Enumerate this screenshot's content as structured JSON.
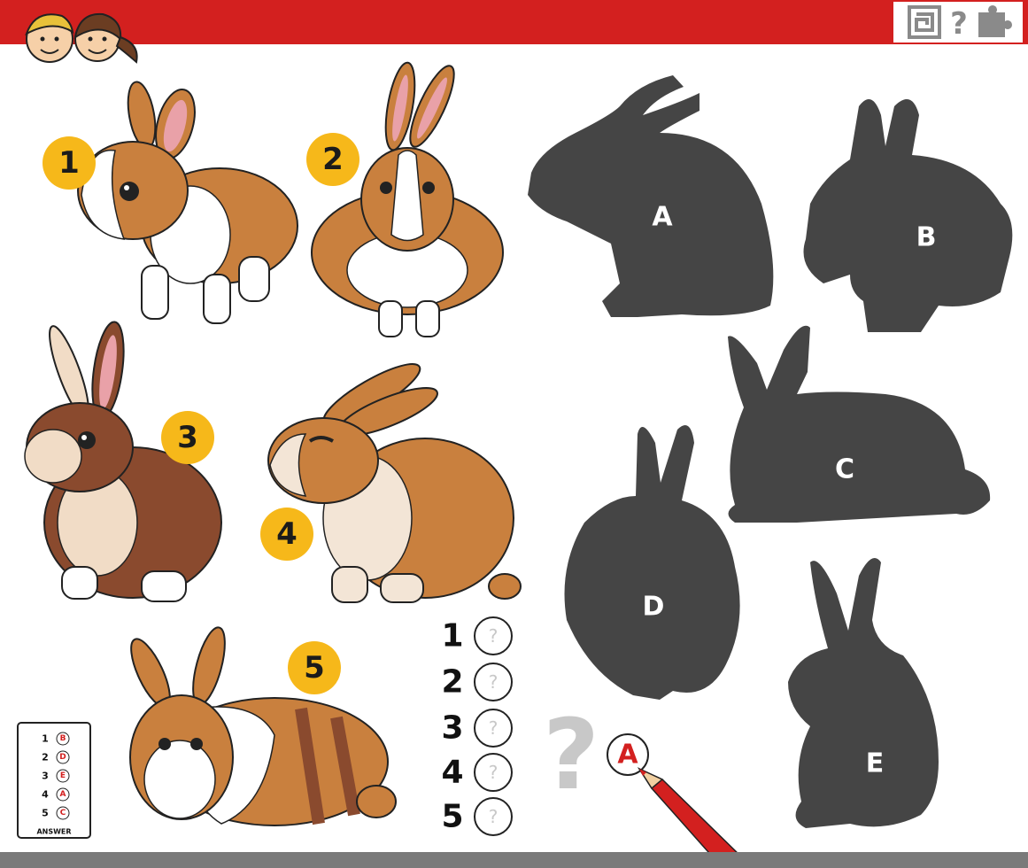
{
  "header": {
    "bar_color": "#d3201f",
    "icons": [
      "maze-icon",
      "question-icon",
      "puzzle-icon"
    ]
  },
  "rabbits": [
    {
      "number": "1"
    },
    {
      "number": "2"
    },
    {
      "number": "3"
    },
    {
      "number": "4"
    },
    {
      "number": "5"
    }
  ],
  "shadows": [
    {
      "letter": "A"
    },
    {
      "letter": "B"
    },
    {
      "letter": "C"
    },
    {
      "letter": "D"
    },
    {
      "letter": "E"
    }
  ],
  "answer_rows": [
    {
      "number": "1",
      "placeholder": "?"
    },
    {
      "number": "2",
      "placeholder": "?"
    },
    {
      "number": "3",
      "placeholder": "?"
    },
    {
      "number": "4",
      "placeholder": "?"
    },
    {
      "number": "5",
      "placeholder": "?"
    }
  ],
  "example": {
    "letter": "A",
    "hint": "?"
  },
  "answer_key": {
    "label": "ANSWER",
    "rows": [
      {
        "number": "1",
        "letter": "B"
      },
      {
        "number": "2",
        "letter": "D"
      },
      {
        "number": "3",
        "letter": "E"
      },
      {
        "number": "4",
        "letter": "A"
      },
      {
        "number": "5",
        "letter": "C"
      }
    ]
  },
  "colors": {
    "accent": "#d3201f",
    "badge": "#f6b81a",
    "shadow": "#454545",
    "fur_orange": "#c9803e",
    "fur_brown": "#8a4a2e"
  }
}
